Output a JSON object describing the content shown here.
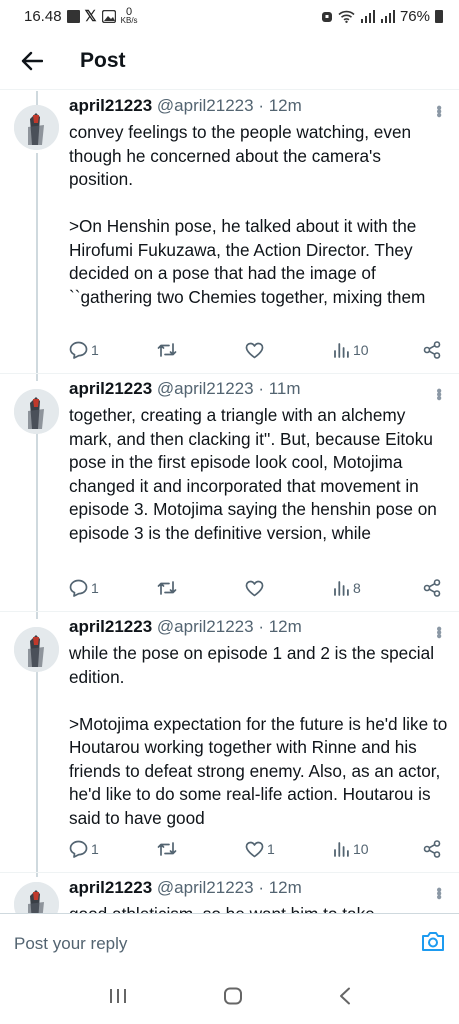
{
  "status_bar": {
    "time": "16.48",
    "net_speed_value": "0",
    "net_speed_unit": "KB/s",
    "battery": "76%"
  },
  "header": {
    "title": "Post"
  },
  "posts": [
    {
      "author": "april21223",
      "handle": "@april21223",
      "time": "· 12m",
      "text": "convey feelings to the people watching, even though he concerned about the camera's position.\n\n>On Henshin pose, he talked about it with the Hirofumi Fukuzawa, the Action Director. They decided on a pose that had the image of ``gathering two Chemies together, mixing them",
      "replies": "1",
      "reposts": "",
      "likes": "",
      "views": "10"
    },
    {
      "author": "april21223",
      "handle": "@april21223",
      "time": "· 11m",
      "text": "together, creating a triangle with an alchemy mark, and then clacking it''. But, because Eitoku pose in the first episode look cool, Motojima changed it and incorporated that movement in episode 3. Motojima saying the henshin pose on episode 3 is the definitive version, while",
      "replies": "1",
      "reposts": "",
      "likes": "",
      "views": "8"
    },
    {
      "author": "april21223",
      "handle": "@april21223",
      "time": "· 12m",
      "text": "while the pose on episode 1 and 2 is the special edition.\n\n>Motojima expectation for the future is he'd like to Houtarou working together with Rinne and his friends to defeat strong enemy. Also, as an actor, he'd like to do some real-life action. Houtarou is said to have good",
      "replies": "1",
      "reposts": "",
      "likes": "1",
      "views": "10"
    },
    {
      "author": "april21223",
      "handle": "@april21223",
      "time": "· 12m",
      "text": "good athleticism, so he want him to take"
    }
  ],
  "reply_bar": {
    "placeholder": "Post your reply"
  },
  "colors": {
    "text": "#0f1419",
    "secondary": "#536471",
    "accent": "#1d9bf0",
    "thread_line": "#cfd9de"
  }
}
